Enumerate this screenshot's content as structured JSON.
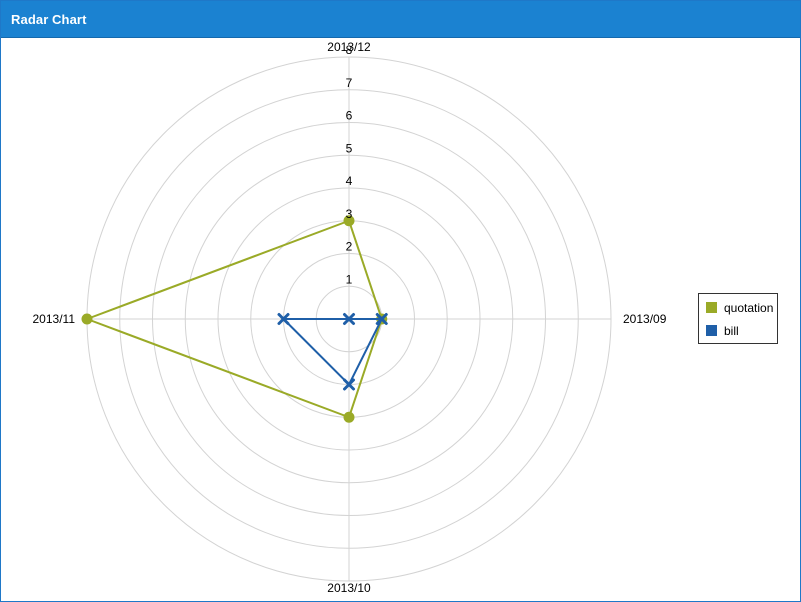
{
  "window": {
    "title": "Radar Chart"
  },
  "chart_data": {
    "type": "radar",
    "axes": [
      "2013/09",
      "2013/10",
      "2013/11",
      "2013/12"
    ],
    "scale": {
      "min": 0,
      "max": 8,
      "ticks": [
        1,
        2,
        3,
        4,
        5,
        6,
        7,
        8
      ]
    },
    "grid": true,
    "legend_position": "right",
    "series": [
      {
        "name": "quotation",
        "values": [
          1,
          3,
          8,
          3
        ],
        "color": "#9aaa27",
        "marker": "circle"
      },
      {
        "name": "bill",
        "values": [
          1,
          2,
          2,
          0
        ],
        "color": "#1f5fa8",
        "marker": "x"
      }
    ]
  }
}
